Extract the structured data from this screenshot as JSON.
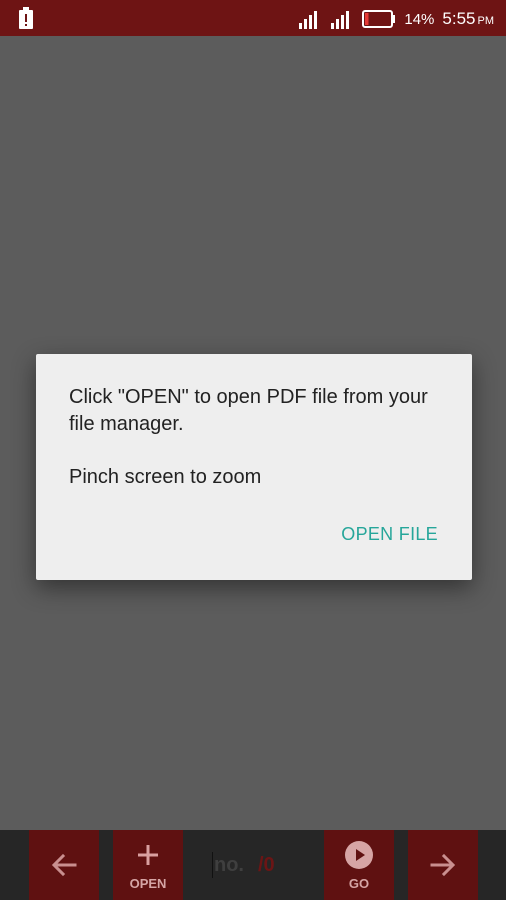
{
  "status_bar": {
    "battery_percent": "14%",
    "time": "5:55",
    "ampm": "PM",
    "icons": [
      "battery-alert-icon",
      "signal-icon",
      "signal-icon",
      "battery-low-icon"
    ],
    "colors": {
      "background": "#6e1414",
      "battery_level": "#e53935"
    },
    "battery_level_fraction": 0.14
  },
  "dialog": {
    "message_line": "Click \"OPEN\" to open PDF file from your file manager.",
    "message_hint": "Pinch screen to zoom",
    "open_file_label": "OPEN FILE",
    "colors": {
      "accent": "#26a69a"
    }
  },
  "toolbar": {
    "back_icon": "arrow-left-icon",
    "open_label": "OPEN",
    "open_icon": "plus-icon",
    "page_input_placeholder": "no.",
    "page_total": "/0",
    "go_label": "GO",
    "go_icon": "play-circle-icon",
    "forward_icon": "arrow-right-icon",
    "colors": {
      "button": "#5f1111",
      "bar": "#262626"
    }
  }
}
